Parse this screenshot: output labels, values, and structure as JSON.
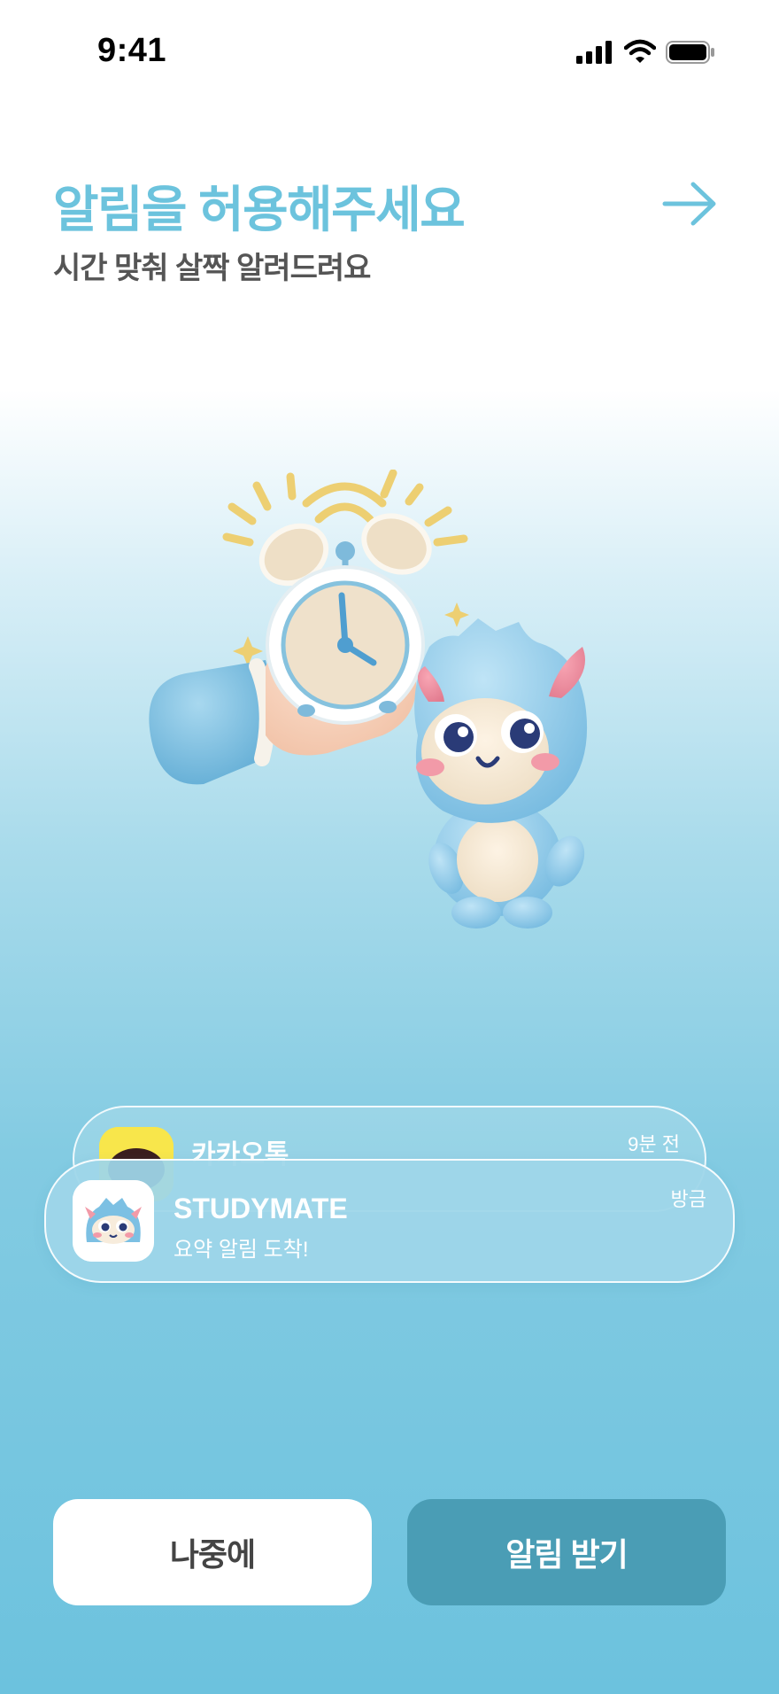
{
  "status_bar": {
    "time": "9:41"
  },
  "header": {
    "title": "알림을 허용해주세요",
    "subtitle": "시간 맞춰 살짝 알려드려요"
  },
  "notifications": [
    {
      "app": "카카오톡",
      "time": "9분 전",
      "icon": "kakaotalk-icon",
      "icon_color": "#f8e64b"
    },
    {
      "app": "STUDYMATE",
      "message": "요약 알림 도착!",
      "time": "방금",
      "icon": "studymate-monster-icon"
    }
  ],
  "buttons": {
    "later": "나중에",
    "allow": "알림 받기"
  },
  "colors": {
    "accent": "#6cc3dd",
    "primary_button": "#4a9db5",
    "subtitle": "#555555"
  }
}
